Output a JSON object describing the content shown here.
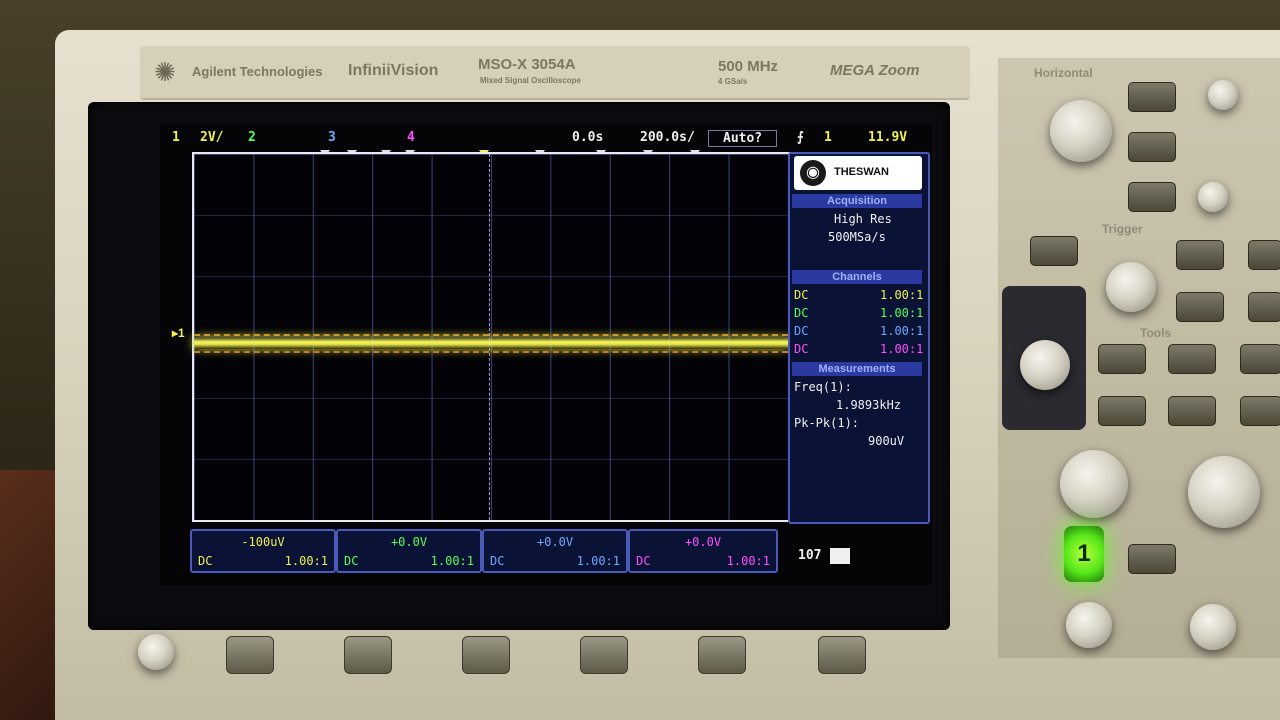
{
  "brand": {
    "maker": "Agilent Technologies",
    "series": "InfiniiVision",
    "model": "MSO-X 3054A",
    "model_sub": "Mixed Signal Oscilloscope",
    "bandwidth": "500 MHz",
    "sample_rate": "4 GSa/s",
    "megazoom": "MEGA Zoom"
  },
  "status_bar": {
    "ch1_num": "1",
    "ch1_scale": "2V/",
    "ch2_num": "2",
    "ch3_num": "3",
    "ch4_num": "4",
    "time_pos": "0.0s",
    "time_scale": "200.0s/",
    "trigger_mode": "Auto?",
    "trigger_icon": "edge-trigger-icon",
    "trigger_src": "1",
    "trigger_level": "11.9V"
  },
  "side_panel": {
    "logo": "THESWAN",
    "acquisition_title": "Acquisition",
    "acq_mode": "High Res",
    "acq_rate": "500MSa/s",
    "channels_title": "Channels",
    "channels": [
      {
        "coupling": "DC",
        "ratio": "1.00:1",
        "color": "#f0f050"
      },
      {
        "coupling": "DC",
        "ratio": "1.00:1",
        "color": "#58ff58"
      },
      {
        "coupling": "DC",
        "ratio": "1.00:1",
        "color": "#70a8ff"
      },
      {
        "coupling": "DC",
        "ratio": "1.00:1",
        "color": "#ff50ff"
      }
    ],
    "measurements_title": "Measurements",
    "meas1_label": "Freq(1):",
    "meas1_value": "1.9893kHz",
    "meas2_label": "Pk-Pk(1):",
    "meas2_value": "900uV"
  },
  "bottom_channels": [
    {
      "offset": "-100uV",
      "coupling": "DC",
      "ratio": "1.00:1",
      "color": "#f0f050"
    },
    {
      "offset": "+0.0V",
      "coupling": "DC",
      "ratio": "1.00:1",
      "color": "#58ff58"
    },
    {
      "offset": "+0.0V",
      "coupling": "DC",
      "ratio": "1.00:1",
      "color": "#70a8ff"
    },
    {
      "offset": "+0.0V",
      "coupling": "DC",
      "ratio": "1.00:1",
      "color": "#ff50ff"
    }
  ],
  "bottom_extra": "107",
  "front_panel": {
    "horizontal": "Horizontal",
    "trigger": "Trigger",
    "tools": "Tools",
    "channel_button": "1"
  },
  "ground_marker": "1",
  "colors": {
    "ch1": "#f0f050",
    "ch2": "#58ff58",
    "ch3": "#70a8ff",
    "ch4": "#ff50ff",
    "panel_border": "#4a5ab8"
  }
}
